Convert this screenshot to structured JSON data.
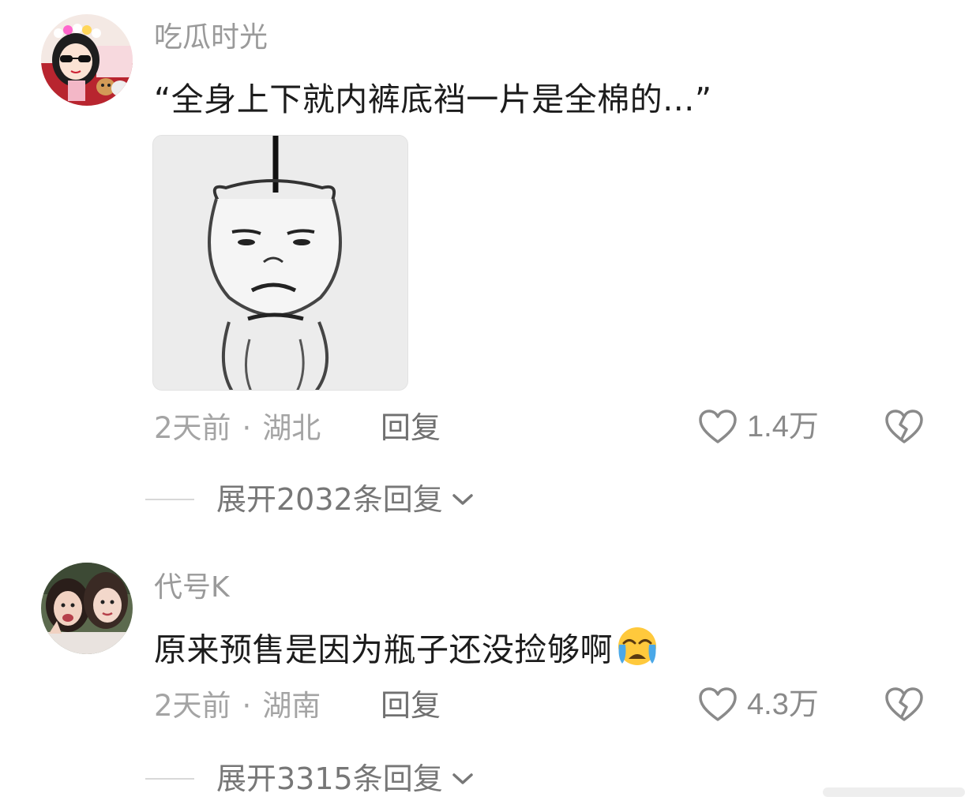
{
  "comments": [
    {
      "username": "吃瓜时光",
      "avatar_icon": "cartoon-girl-avatar",
      "content": "“全身上下就内裤底裆一片是全棉的...”",
      "sticker_icon": "hanging-panda-meme-sticker",
      "time": "2天前",
      "separator": "·",
      "location": "湖北",
      "reply_label": "回复",
      "like_count": "1.4万",
      "expand_label": "展开2032条回复"
    },
    {
      "username": "代号K",
      "avatar_icon": "two-girls-photo-avatar",
      "content": "原来预售是因为瓶子还没捡够啊",
      "emoji_icon": "crying-face-emoji",
      "time": "2天前",
      "separator": "·",
      "location": "湖南",
      "reply_label": "回复",
      "like_count": "4.3万",
      "expand_label": "展开3315条回复"
    }
  ],
  "colors": {
    "username": "#9a9a9a",
    "text": "#1c1c1c",
    "meta": "#a4a4a4",
    "icon_stroke": "#8a8a8a",
    "emoji_face": "#ffc93c",
    "emoji_tears": "#4aa8e8"
  }
}
